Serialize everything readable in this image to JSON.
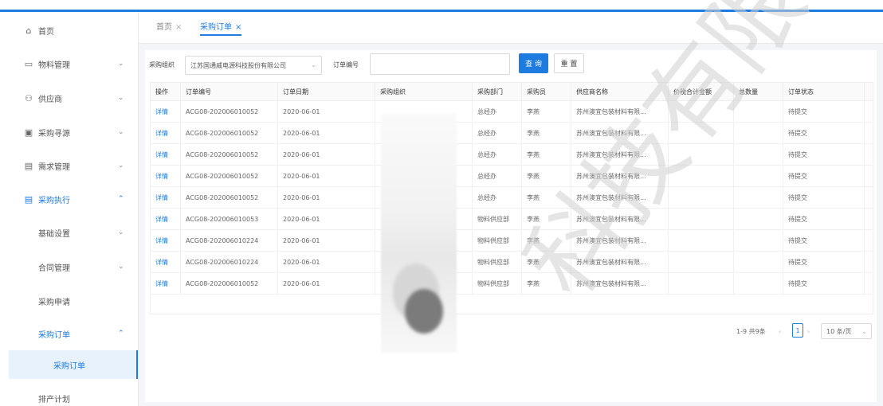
{
  "sidebar": {
    "items": [
      {
        "label": "首页",
        "icon": "home-icon",
        "glyph": "⌂"
      },
      {
        "label": "物料管理",
        "icon": "folder-icon",
        "glyph": "▭",
        "chevron": "⌄"
      },
      {
        "label": "供应商",
        "icon": "supplier-icon",
        "glyph": "⚇",
        "chevron": "⌄"
      },
      {
        "label": "采购寻源",
        "icon": "sourcing-icon",
        "glyph": "▣",
        "chevron": "⌄"
      },
      {
        "label": "需求管理",
        "icon": "list-icon",
        "glyph": "▤",
        "chevron": "⌄"
      },
      {
        "label": "采购执行",
        "icon": "execution-icon",
        "glyph": "▤",
        "chevron": "⌃"
      },
      {
        "label": "基础设置",
        "chevron": "⌄"
      },
      {
        "label": "合同管理",
        "chevron": "⌄"
      },
      {
        "label": "采购申请"
      },
      {
        "label": "采购订单",
        "chevron": "⌃"
      },
      {
        "label": "采购订单"
      },
      {
        "label": "排产计划"
      }
    ]
  },
  "tabs": [
    {
      "label": "首页",
      "close": "×"
    },
    {
      "label": "采购订单",
      "close": "×"
    }
  ],
  "filters": {
    "org_label": "采购组织",
    "org_value": "江苏国通威电源科技股份有限公司",
    "org_arrow": "⌄",
    "order_no_label": "订单编号",
    "order_no_value": "",
    "search_label": "查 询",
    "reset_label": "重 置"
  },
  "table": {
    "columns": [
      "操作",
      "订单编号",
      "订单日期",
      "采购组织",
      "采购部门",
      "采购员",
      "供应商名称",
      "价税合计金额",
      "总数量",
      "订单状态"
    ],
    "rows": [
      {
        "action": "详情",
        "order_no": "ACG08-202006010052",
        "date": "2020-06-01",
        "org": "",
        "dept": "总经办",
        "buyer": "李燕",
        "supplier": "苏州澳宜包装材料有限...",
        "amount": "",
        "qty": "",
        "status": "待提交"
      },
      {
        "action": "详情",
        "order_no": "ACG08-202006010052",
        "date": "2020-06-01",
        "org": "",
        "dept": "总经办",
        "buyer": "李燕",
        "supplier": "苏州澳宜包装材料有限...",
        "amount": "",
        "qty": "",
        "status": "待提交"
      },
      {
        "action": "详情",
        "order_no": "ACG08-202006010052",
        "date": "2020-06-01",
        "org": "",
        "dept": "总经办",
        "buyer": "李燕",
        "supplier": "苏州澳宜包装材料有限...",
        "amount": "",
        "qty": "",
        "status": "待提交"
      },
      {
        "action": "详情",
        "order_no": "ACG08-202006010052",
        "date": "2020-06-01",
        "org": "",
        "dept": "总经办",
        "buyer": "李燕",
        "supplier": "苏州澳宜包装材料有限...",
        "amount": "",
        "qty": "",
        "status": "待提交"
      },
      {
        "action": "详情",
        "order_no": "ACG08-202006010052",
        "date": "2020-06-01",
        "org": "",
        "dept": "总经办",
        "buyer": "李燕",
        "supplier": "苏州澳宜包装材料有限...",
        "amount": "",
        "qty": "",
        "status": "待提交"
      },
      {
        "action": "详情",
        "order_no": "ACG08-202006010053",
        "date": "2020-06-01",
        "org": "",
        "dept": "物料供应部",
        "buyer": "李燕",
        "supplier": "苏州澳宜包装材料有限...",
        "amount": "",
        "qty": "",
        "status": "待提交"
      },
      {
        "action": "详情",
        "order_no": "ACG08-202006010224",
        "date": "2020-06-01",
        "org": "",
        "dept": "物料供应部",
        "buyer": "李燕",
        "supplier": "苏州澳宜包装材料有限...",
        "amount": "",
        "qty": "",
        "status": "待提交"
      },
      {
        "action": "详情",
        "order_no": "ACG08-202006010224",
        "date": "2020-06-01",
        "org": "",
        "dept": "物料供应部",
        "buyer": "李燕",
        "supplier": "苏州澳宜包装材料有限...",
        "amount": "",
        "qty": "",
        "status": "待提交"
      },
      {
        "action": "详情",
        "order_no": "ACG08-202006010052",
        "date": "2020-06-01",
        "org": "",
        "dept": "物料供应部",
        "buyer": "李燕",
        "supplier": "苏州澳宜包装材料有限...",
        "amount": "",
        "qty": "",
        "status": "待提交"
      }
    ]
  },
  "pagination": {
    "total_text": "1-9 共9条",
    "prev": "‹",
    "current": "1",
    "next": "›",
    "page_size": "10 条/页",
    "size_arrow": "⌄"
  },
  "watermark": {
    "text": "科技有限公",
    "color": "#d0d0d0"
  },
  "colors": {
    "accent": "#1e7be0",
    "panel_bg": "#f3f5f8"
  }
}
